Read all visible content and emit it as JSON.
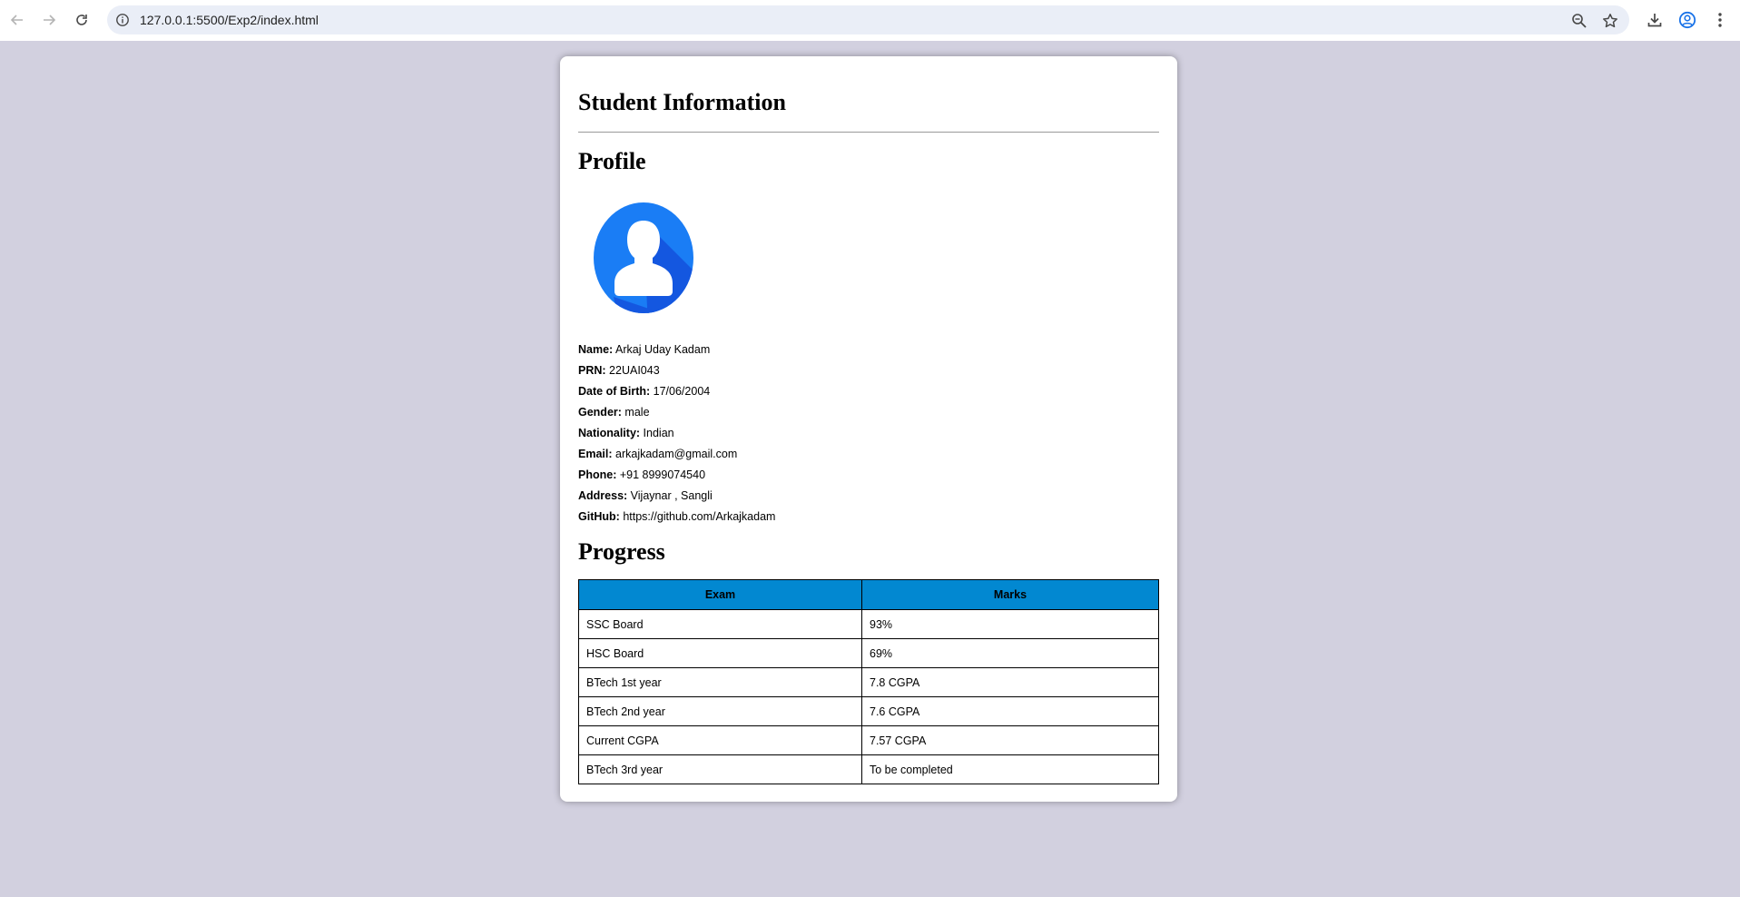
{
  "browser": {
    "url": "127.0.0.1:5500/Exp2/index.html",
    "icons": [
      "back-arrow-icon",
      "forward-arrow-icon",
      "reload-icon",
      "site-info-icon",
      "zoom-icon",
      "bookmark-star-icon",
      "download-icon",
      "profile-icon",
      "more-menu-icon"
    ]
  },
  "page": {
    "title": "Student Information",
    "profile_heading": "Profile",
    "progress_heading": "Progress",
    "avatar_colors": {
      "circle": "#1a7df5",
      "shadow": "#1457e0",
      "figure": "#ffffff"
    }
  },
  "profile": {
    "fields": [
      {
        "label": "Name:",
        "value": "Arkaj Uday Kadam"
      },
      {
        "label": "PRN:",
        "value": "22UAI043"
      },
      {
        "label": "Date of Birth:",
        "value": "17/06/2004"
      },
      {
        "label": "Gender:",
        "value": "male"
      },
      {
        "label": "Nationality:",
        "value": "Indian"
      },
      {
        "label": "Email:",
        "value": "arkajkadam@gmail.com"
      },
      {
        "label": "Phone:",
        "value": "+91 8999074540"
      },
      {
        "label": "Address:",
        "value": "Vijaynar , Sangli"
      },
      {
        "label": "GitHub:",
        "value": "https://github.com/Arkajkadam"
      }
    ]
  },
  "progress": {
    "header_color": "#0288d1",
    "columns": [
      "Exam",
      "Marks"
    ],
    "rows": [
      [
        "SSC Board",
        "93%"
      ],
      [
        "HSC Board",
        "69%"
      ],
      [
        "BTech 1st year",
        "7.8 CGPA"
      ],
      [
        "BTech 2nd year",
        "7.6 CGPA"
      ],
      [
        "Current CGPA",
        "7.57 CGPA"
      ],
      [
        "BTech 3rd year",
        "To be completed"
      ]
    ]
  }
}
